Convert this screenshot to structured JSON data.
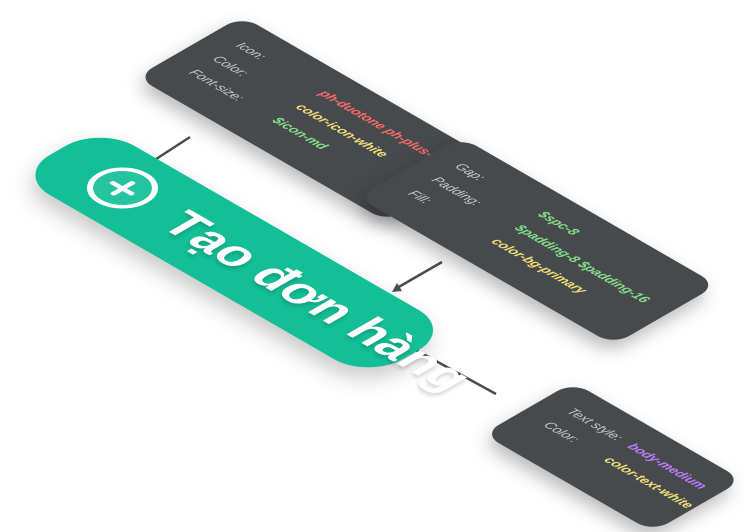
{
  "colors": {
    "card_bg": "#474a4d",
    "primary_green": "#13bf96",
    "label_grey": "#c8cbcd",
    "value_red": "#ff6b6b",
    "value_yellow": "#f5e07a",
    "value_green": "#86e08a",
    "value_purple": "#c07cff",
    "connector": "#4a4d50"
  },
  "button": {
    "icon": "plus-circle-icon",
    "label": "Tạo đơn hàng"
  },
  "icon_card": {
    "rows": [
      {
        "label": "Icon:",
        "value": "ph-duotone ph-plus-circle"
      },
      {
        "label": "Color:",
        "value": "color-icon-white"
      },
      {
        "label": "Font-size:",
        "value": "$icon-md"
      }
    ]
  },
  "layout_card": {
    "rows": [
      {
        "label": "Gap:",
        "value": "$spc-8"
      },
      {
        "label": "Padding:",
        "value": "$padding-8 $padding-16"
      },
      {
        "label": "Fill:",
        "value": "color-bg-primary"
      }
    ]
  },
  "text_card": {
    "rows": [
      {
        "label": "Text style:",
        "value": "body-medium"
      },
      {
        "label": "Color:",
        "value": "color-text-white"
      }
    ]
  }
}
